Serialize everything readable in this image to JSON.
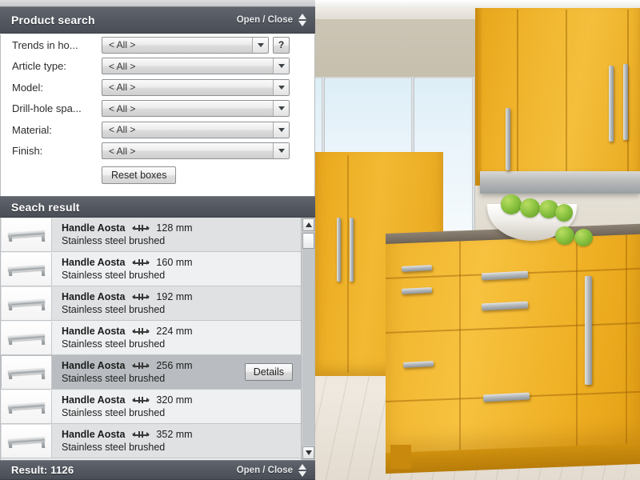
{
  "header": {
    "title": "Product search",
    "open_close_label": "Open / Close",
    "toggle_icon": "up-down-arrows-icon"
  },
  "search_form": {
    "fields": [
      {
        "label": "Trends in ho...",
        "value": "< All >",
        "has_help": true,
        "help_label": "?"
      },
      {
        "label": "Article type:",
        "value": "< All >",
        "has_help": false,
        "help_label": ""
      },
      {
        "label": "Model:",
        "value": "< All >",
        "has_help": false,
        "help_label": ""
      },
      {
        "label": "Drill-hole spa...",
        "value": "< All >",
        "has_help": false,
        "help_label": ""
      },
      {
        "label": "Material:",
        "value": "< All >",
        "has_help": false,
        "help_label": ""
      },
      {
        "label": "Finish:",
        "value": "< All >",
        "has_help": false,
        "help_label": ""
      }
    ],
    "reset_label": "Reset boxes",
    "dropdown_icon": "chevron-down-icon"
  },
  "results_header": {
    "title": "Seach result"
  },
  "results": {
    "dimension_icon": "dimension-arrows-icon",
    "details_label": "Details",
    "items": [
      {
        "name": "Handle Aosta",
        "size": "128 mm",
        "finish": "Stainless steel brushed",
        "selected": false
      },
      {
        "name": "Handle Aosta",
        "size": "160 mm",
        "finish": "Stainless steel brushed",
        "selected": false
      },
      {
        "name": "Handle Aosta",
        "size": "192 mm",
        "finish": "Stainless steel brushed",
        "selected": false
      },
      {
        "name": "Handle Aosta",
        "size": "224 mm",
        "finish": "Stainless steel brushed",
        "selected": false
      },
      {
        "name": "Handle Aosta",
        "size": "256 mm",
        "finish": "Stainless steel brushed",
        "selected": true
      },
      {
        "name": "Handle Aosta",
        "size": "320 mm",
        "finish": "Stainless steel brushed",
        "selected": false
      },
      {
        "name": "Handle Aosta",
        "size": "352 mm",
        "finish": "Stainless steel brushed",
        "selected": false
      }
    ]
  },
  "scrollbar": {
    "up_icon": "triangle-up-icon",
    "down_icon": "triangle-down-icon"
  },
  "footer": {
    "result_label": "Result: 1126",
    "open_close_label": "Open / Close",
    "toggle_icon": "up-down-arrows-icon"
  },
  "colors": {
    "bar_dark": "#525760",
    "accent_cabinet": "#f0b42c",
    "selected_row": "#b9bdc1",
    "panel_bg": "#ffffff"
  }
}
